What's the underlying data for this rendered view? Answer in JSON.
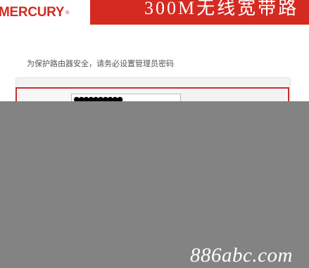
{
  "header": {
    "logo": "MERCURY",
    "logo_reg": "®",
    "product_title": "300M无线宽带路"
  },
  "prompt": "为保护路由器安全，请务必设置管理员密码",
  "password": {
    "masked_value": "●●●●●●●●●●"
  },
  "watermark": "886abc.com",
  "colors": {
    "brand_red": "#d42a22",
    "overlay_gray": "#838383"
  }
}
